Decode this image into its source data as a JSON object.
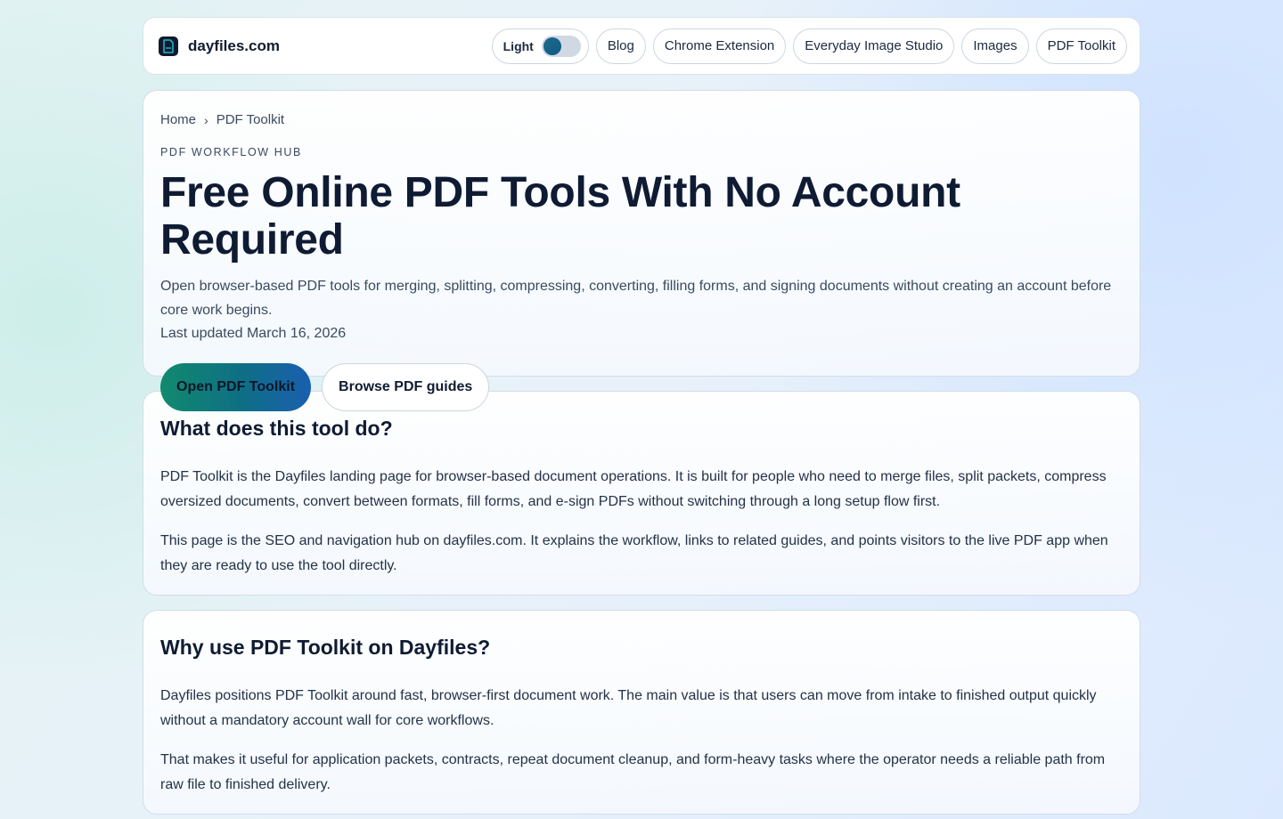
{
  "header": {
    "brand": "dayfiles.com",
    "theme_toggle_label": "Light",
    "nav": [
      "Blog",
      "Chrome Extension",
      "Everyday Image Studio",
      "Images",
      "PDF Toolkit"
    ]
  },
  "hero": {
    "breadcrumb": [
      "Home",
      "PDF Toolkit"
    ],
    "breadcrumb_separator": "›",
    "eyebrow": "PDF WORKFLOW HUB",
    "title": "Free Online PDF Tools With No Account Required",
    "description": "Open browser-based PDF tools for merging, splitting, compressing, converting, filling forms, and signing documents without creating an account before core work begins.",
    "updated": "Last updated March 16, 2026",
    "primary_button": "Open PDF Toolkit",
    "secondary_button": "Browse PDF guides"
  },
  "sections": [
    {
      "heading": "What does this tool do?",
      "paragraphs": [
        "PDF Toolkit is the Dayfiles landing page for browser-based document operations. It is built for people who need to merge files, split packets, compress oversized documents, convert between formats, fill forms, and e-sign PDFs without switching through a long setup flow first.",
        "This page is the SEO and navigation hub on dayfiles.com. It explains the workflow, links to related guides, and points visitors to the live PDF app when they are ready to use the tool directly."
      ]
    },
    {
      "heading": "Why use PDF Toolkit on Dayfiles?",
      "paragraphs": [
        "Dayfiles positions PDF Toolkit around fast, browser-first document work. The main value is that users can move from intake to finished output quickly without a mandatory account wall for core workflows.",
        "That makes it useful for application packets, contracts, repeat document cleanup, and form-heavy tasks where the operator needs a reliable path from raw file to finished delivery."
      ]
    }
  ],
  "colors": {
    "accent_gradient_start": "#118a6e",
    "accent_gradient_end": "#1a5fb0",
    "text_primary": "#0f1b33"
  },
  "icons": {
    "brand_logo": "document-icon"
  }
}
